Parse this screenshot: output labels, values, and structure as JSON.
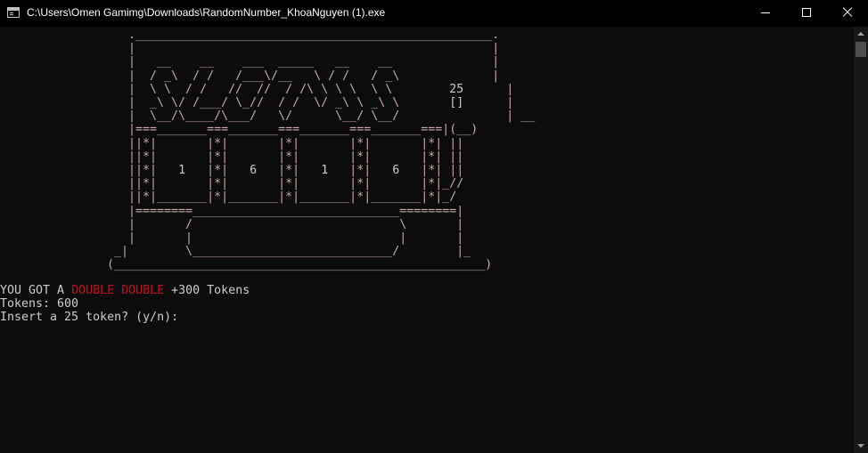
{
  "window": {
    "title": "C:\\Users\\Omen Gamimg\\Downloads\\RandomNumber_KhoaNguyen (1).exe",
    "icon": "console-app-icon",
    "controls": [
      "minimize-icon",
      "maximize-icon",
      "close-icon"
    ]
  },
  "machine": {
    "cost_display": "25",
    "coin_slot": "[]",
    "reels": [
      "1",
      "6",
      "1",
      "6"
    ]
  },
  "output": {
    "result_prefix": "YOU GOT A ",
    "result_highlight": "DOUBLE DOUBLE",
    "result_suffix": " +300 Tokens",
    "tokens_line": "Tokens: 600",
    "prompt": "Insert a 25 token? (y/n):"
  },
  "colors": {
    "console_bg": "#0c0c0c",
    "text": "#cccccc",
    "machine_border": "#c9a9a6",
    "highlight_red": "#c50f1f"
  }
}
